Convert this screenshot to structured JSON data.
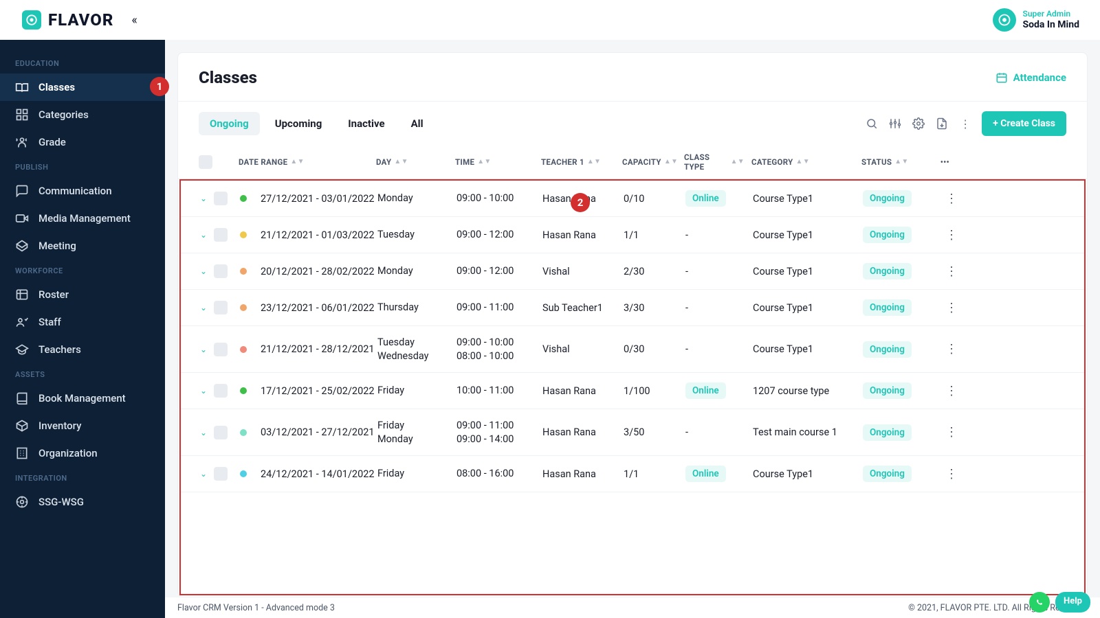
{
  "brand": "FLAVOR",
  "user": {
    "role": "Super Admin",
    "name": "Soda In Mind"
  },
  "sidebar": {
    "sections": [
      {
        "title": "EDUCATION",
        "items": [
          {
            "label": "Classes",
            "active": true
          },
          {
            "label": "Categories"
          },
          {
            "label": "Grade"
          }
        ]
      },
      {
        "title": "PUBLISH",
        "items": [
          {
            "label": "Communication"
          },
          {
            "label": "Media Management"
          },
          {
            "label": "Meeting"
          }
        ]
      },
      {
        "title": "WORKFORCE",
        "items": [
          {
            "label": "Roster"
          },
          {
            "label": "Staff"
          },
          {
            "label": "Teachers"
          }
        ]
      },
      {
        "title": "ASSETS",
        "items": [
          {
            "label": "Book Management"
          },
          {
            "label": "Inventory"
          },
          {
            "label": "Organization"
          }
        ]
      },
      {
        "title": "INTEGRATION",
        "items": [
          {
            "label": "SSG-WSG"
          }
        ]
      }
    ]
  },
  "page": {
    "title": "Classes",
    "attendance": "Attendance"
  },
  "tabs": {
    "ongoing": "Ongoing",
    "upcoming": "Upcoming",
    "inactive": "Inactive",
    "all": "All"
  },
  "create_btn": "+ Create Class",
  "columns": {
    "date": "DATE RANGE",
    "day": "DAY",
    "time": "TIME",
    "teacher": "TEACHER 1",
    "capacity": "CAPACITY",
    "classtype": "CLASS TYPE",
    "category": "CATEGORY",
    "status": "STATUS"
  },
  "rows": [
    {
      "dot": "#3fbf4a",
      "date": "27/12/2021 - 03/01/2022",
      "day": [
        "Monday"
      ],
      "time": [
        "09:00 - 10:00"
      ],
      "teacher": "Hasan Rana",
      "cap": "0/10",
      "type": "Online",
      "cat": "Course Type1",
      "status": "Ongoing"
    },
    {
      "dot": "#efc94c",
      "date": "21/12/2021 - 01/03/2022",
      "day": [
        "Tuesday"
      ],
      "time": [
        "09:00 - 12:00"
      ],
      "teacher": "Hasan Rana",
      "cap": "1/1",
      "type": "-",
      "cat": "Course Type1",
      "status": "Ongoing"
    },
    {
      "dot": "#f0a66a",
      "date": "20/12/2021 - 28/02/2022",
      "day": [
        "Monday"
      ],
      "time": [
        "09:00 - 12:00"
      ],
      "teacher": "Vishal",
      "cap": "2/30",
      "type": "-",
      "cat": "Course Type1",
      "status": "Ongoing"
    },
    {
      "dot": "#f0a66a",
      "date": "23/12/2021 - 06/01/2022",
      "day": [
        "Thursday"
      ],
      "time": [
        "09:00 - 11:00"
      ],
      "teacher": "Sub Teacher1",
      "cap": "3/30",
      "type": "-",
      "cat": "Course Type1",
      "status": "Ongoing"
    },
    {
      "dot": "#f08a7a",
      "date": "21/12/2021 - 28/12/2021",
      "day": [
        "Tuesday",
        "Wednesday"
      ],
      "time": [
        "09:00 - 10:00",
        "08:00 - 10:00"
      ],
      "teacher": "Vishal",
      "cap": "0/30",
      "type": "-",
      "cat": "Course Type1",
      "status": "Ongoing"
    },
    {
      "dot": "#3fbf4a",
      "date": "17/12/2021 - 25/02/2022",
      "day": [
        "Friday"
      ],
      "time": [
        "10:00 - 11:00"
      ],
      "teacher": "Hasan Rana",
      "cap": "1/100",
      "type": "Online",
      "cat": "1207 course type",
      "status": "Ongoing"
    },
    {
      "dot": "#7ee0c6",
      "date": "03/12/2021 - 27/12/2021",
      "day": [
        "Friday",
        "Monday"
      ],
      "time": [
        "09:00 - 11:00",
        "09:00 - 14:00"
      ],
      "teacher": "Hasan Rana",
      "cap": "3/50",
      "type": "-",
      "cat": "Test main course 1",
      "status": "Ongoing"
    },
    {
      "dot": "#4ecfe6",
      "date": "24/12/2021 - 14/01/2022",
      "day": [
        "Friday"
      ],
      "time": [
        "08:00 - 16:00"
      ],
      "teacher": "Hasan Rana",
      "cap": "1/1",
      "type": "Online",
      "cat": "Course Type1",
      "status": "Ongoing"
    }
  ],
  "footer": {
    "left": "Flavor CRM Version 1 - Advanced mode 3",
    "right": "© 2021, FLAVOR PTE. LTD. All Rights Reserved."
  },
  "help": "Help",
  "callouts": {
    "c1": "1",
    "c2": "2"
  }
}
